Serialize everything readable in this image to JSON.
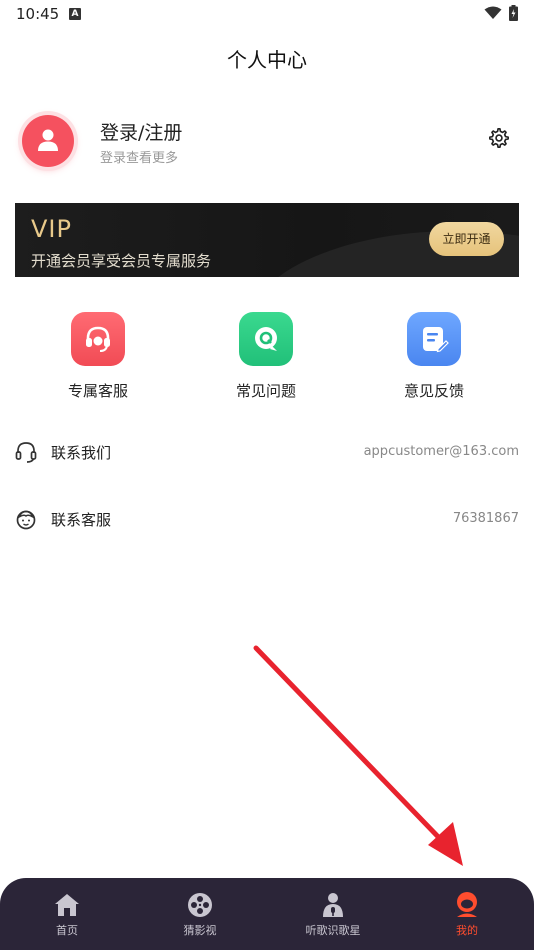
{
  "status_bar": {
    "time": "10:45",
    "notification_icon": "A"
  },
  "header": {
    "title": "个人中心"
  },
  "profile": {
    "title": "登录/注册",
    "subtitle": "登录查看更多",
    "settings_icon": "gear-icon"
  },
  "vip": {
    "title": "VIP",
    "subtitle": "开通会员享受会员专属服务",
    "button": "立即开通"
  },
  "quick_actions": [
    {
      "label": "专属客服",
      "icon": "headset-icon",
      "color": "#f14b55"
    },
    {
      "label": "常见问题",
      "icon": "question-chat-icon",
      "color": "#21c079"
    },
    {
      "label": "意见反馈",
      "icon": "feedback-edit-icon",
      "color": "#4a86f0"
    }
  ],
  "contact": [
    {
      "label": "联系我们",
      "value": "appcustomer@163.com",
      "icon": "headphones-icon"
    },
    {
      "label": "联系客服",
      "value": "76381867",
      "icon": "service-face-icon"
    }
  ],
  "bottom_nav": [
    {
      "label": "首页",
      "icon": "home-icon",
      "active": false
    },
    {
      "label": "猜影视",
      "icon": "film-reel-icon",
      "active": false
    },
    {
      "label": "听歌识歌星",
      "icon": "singer-icon",
      "active": false
    },
    {
      "label": "我的",
      "icon": "profile-icon",
      "active": true
    }
  ],
  "colors": {
    "accent": "#ff4d2e",
    "vip_gold": "#e8c98a",
    "nav_bg": "#2b2538",
    "annotation_arrow": "#e8232e"
  }
}
